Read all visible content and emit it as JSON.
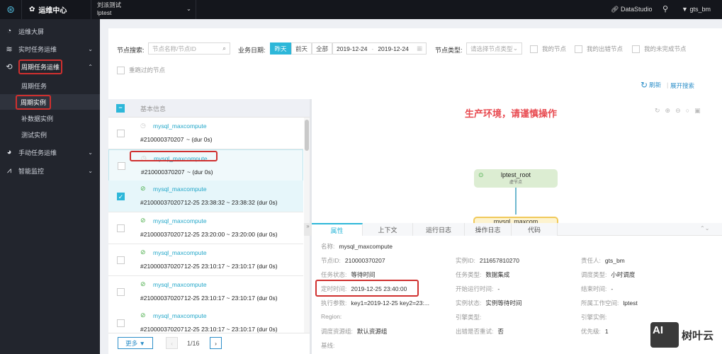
{
  "topbar": {
    "app_name": "运维中心",
    "project_name": "刘派测试",
    "project_id": "lptest",
    "datastudio": "DataStudio",
    "user": "gts_bm"
  },
  "sidebar": {
    "items": [
      {
        "label": "运维大屏",
        "icon": "pie-chart-icon"
      },
      {
        "label": "实时任务运维",
        "icon": "stream-icon"
      },
      {
        "label": "周期任务运维",
        "icon": "cycle-icon"
      },
      {
        "label": "周期任务"
      },
      {
        "label": "周期实例"
      },
      {
        "label": "补数据实例"
      },
      {
        "label": "测试实例"
      },
      {
        "label": "手动任务运维",
        "icon": "manual-icon"
      },
      {
        "label": "智能监控",
        "icon": "monitor-icon"
      }
    ]
  },
  "filters": {
    "search_label": "节点搜索:",
    "search_placeholder": "节点名称/节点ID",
    "date_label": "业务日期:",
    "date_buttons": [
      "昨天",
      "前天",
      "全部"
    ],
    "date_from": "2019-12-24",
    "date_sep": "-",
    "date_to": "2019-12-24",
    "type_label": "节点类型:",
    "type_placeholder": "请选择节点类型",
    "my_nodes": "我的节点",
    "my_error_nodes": "我的出错节点",
    "my_unfinished": "我的未完成节点",
    "rerun_nodes": "重跑过的节点",
    "refresh": "刷新",
    "expand_search": "展开搜索"
  },
  "list": {
    "header": "基本信息",
    "rows": [
      {
        "name": "mysql_maxcompute",
        "id": "#210000370207",
        "time": "~ (dur 0s)",
        "status": "waiting"
      },
      {
        "name": "mysql_maxcompute",
        "id": "#210000370207",
        "time": "~ (dur 0s)",
        "status": "waiting"
      },
      {
        "name": "mysql_maxcompute",
        "id": "#210000370207",
        "time": "12-25 23:38:32 ~ 23:38:32 (dur 0s)",
        "status": "success"
      },
      {
        "name": "mysql_maxcompute",
        "id": "#210000370207",
        "time": "12-25 23:20:00 ~ 23:20:00 (dur 0s)",
        "status": "success"
      },
      {
        "name": "mysql_maxcompute",
        "id": "#210000370207",
        "time": "12-25 23:10:17 ~ 23:10:17 (dur 0s)",
        "status": "success"
      },
      {
        "name": "mysql_maxcompute",
        "id": "#210000370207",
        "time": "12-25 23:10:17 ~ 23:10:17 (dur 0s)",
        "status": "success"
      },
      {
        "name": "mysql_maxcompute",
        "id": "#210000370207",
        "time": "12-25 23:10:17 ~ 23:10:17 (dur 0s)",
        "status": "success"
      }
    ],
    "more": "更多",
    "page": "1/16"
  },
  "graph": {
    "warning": "生产环境，请谨慎操作",
    "root_node": "lptest_root",
    "root_sub": "虚节点",
    "child_node": "mysql_maxcom"
  },
  "tabs": [
    "属性",
    "上下文",
    "运行日志",
    "操作日志",
    "代码"
  ],
  "details": {
    "name_l": "名称:",
    "name_v": "mysql_maxcompute",
    "node_id_l": "节点ID:",
    "node_id_v": "210000370207",
    "inst_id_l": "实例ID:",
    "inst_id_v": "211657810270",
    "owner_l": "责任人:",
    "owner_v": "gts_bm",
    "task_status_l": "任务状态:",
    "task_status_v": "等待时间",
    "task_type_l": "任务类型:",
    "task_type_v": "数据集成",
    "sched_type_l": "调度类型:",
    "sched_type_v": "小时调度",
    "timed_l": "定时时间:",
    "timed_v": "2019-12-25 23:40:00",
    "start_l": "开始运行时间:",
    "start_v": "-",
    "end_l": "结束时间:",
    "end_v": "-",
    "params_l": "执行参数:",
    "params_v": "key1=2019-12-25 key2=23:...",
    "inst_status_l": "实例状态:",
    "inst_status_v": "实例等待时间",
    "workspace_l": "所属工作空间:",
    "workspace_v": "lptest",
    "region_l": "Region:",
    "engine_type_l": "引擎类型:",
    "engine_inst_l": "引擎实例:",
    "res_group_l": "调度资源组:",
    "res_group_v": "默认资源组",
    "retry_l": "出错是否重试:",
    "retry_v": "否",
    "priority_l": "优先级:",
    "priority_v": "1",
    "baseline_l": "基线:"
  },
  "watermark": "树叶云"
}
